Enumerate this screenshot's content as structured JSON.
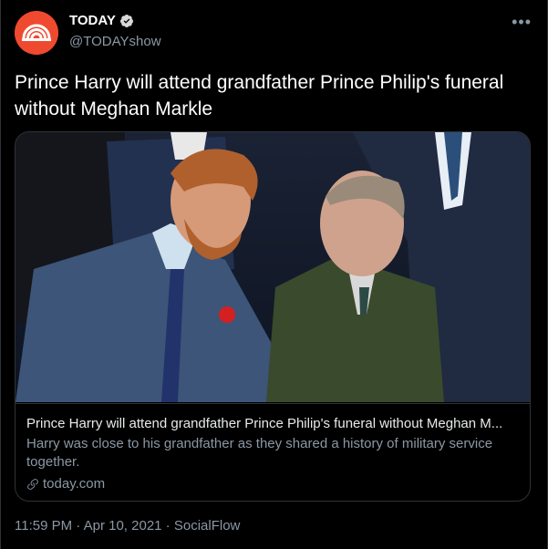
{
  "account": {
    "name": "TODAY",
    "handle": "@TODAYshow",
    "brand_color": "#ef4a2f"
  },
  "tweet": {
    "text": "Prince Harry will attend grandfather Prince Philip's funeral without Meghan Markle"
  },
  "card": {
    "title": "Prince Harry will attend grandfather Prince Philip's funeral without Meghan M...",
    "description": "Harry was close to his grandfather as they shared a history of military service together.",
    "domain": "today.com",
    "image_icon": "photo"
  },
  "meta": {
    "time": "11:59 PM",
    "separator": " · ",
    "date": "Apr 10, 2021",
    "source": "SocialFlow"
  },
  "icons": {
    "more": "more-icon",
    "verified": "verified-badge-icon",
    "link": "link-icon"
  }
}
